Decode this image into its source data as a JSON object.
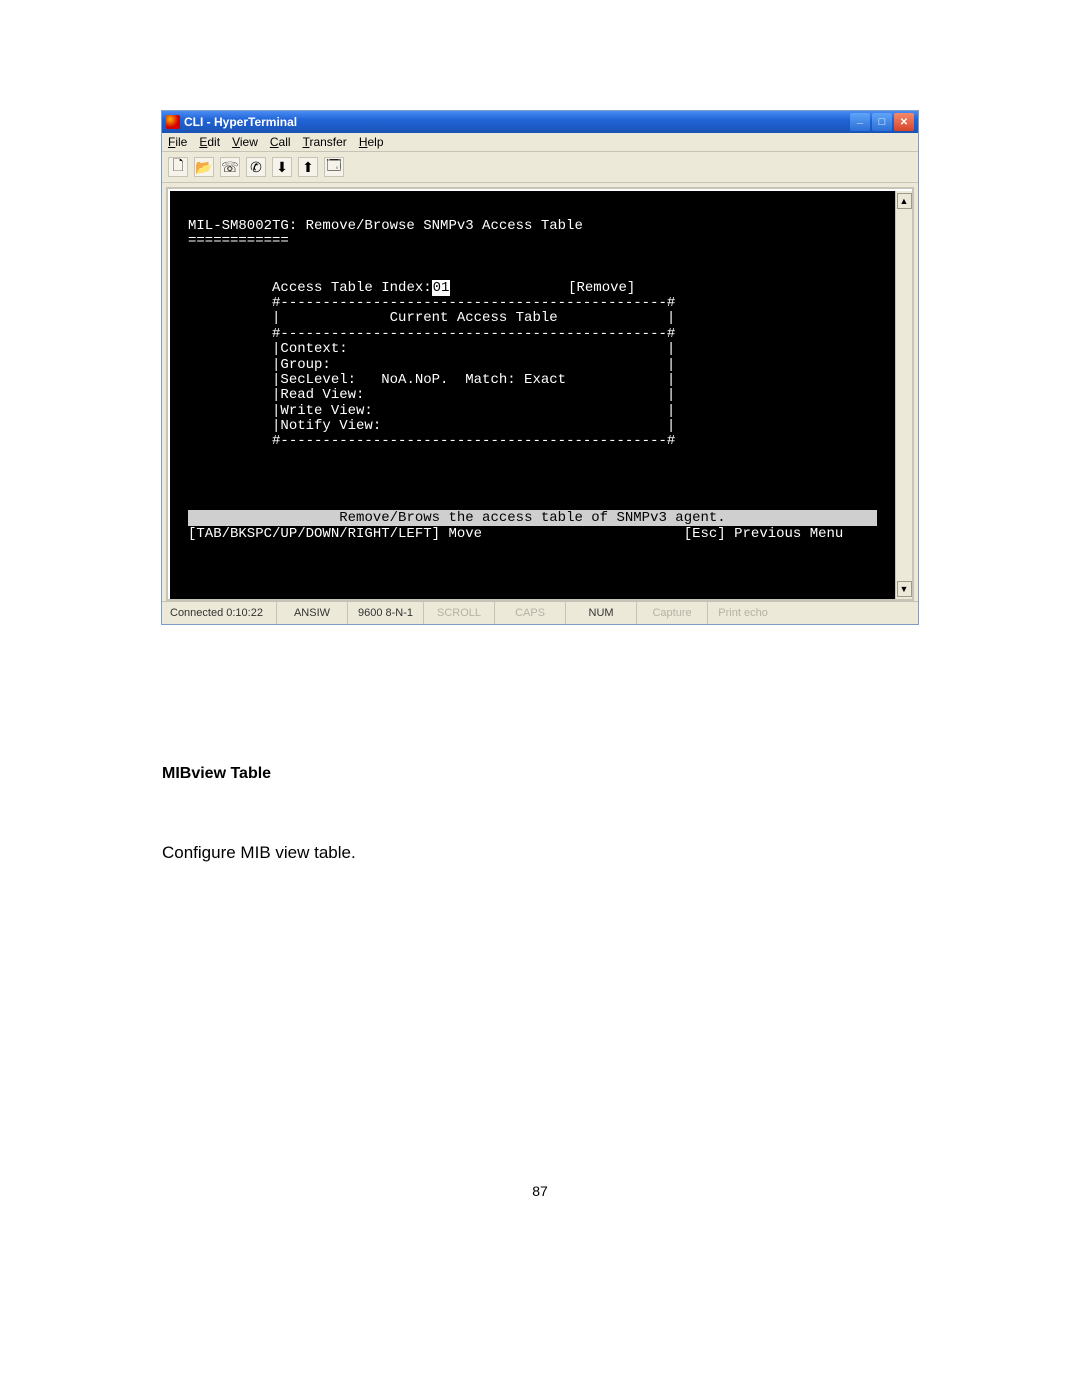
{
  "window": {
    "title": "CLI - HyperTerminal"
  },
  "menu": {
    "file": "File",
    "edit": "Edit",
    "view": "View",
    "call": "Call",
    "transfer": "Transfer",
    "help": "Help"
  },
  "terminal": {
    "header_line": "MIL-SM8002TG: Remove/Browse SNMPv3 Access Table",
    "header_underline": "============",
    "index_label": "Access Table Index:",
    "index_value": "01",
    "remove_label": "[Remove]",
    "border_top": "#----------------------------------------------#",
    "table_title_line": "|             Current Access Table             |",
    "border_mid": "#----------------------------------------------#",
    "row_context": "|Context:                                      |",
    "row_group": "|Group:                                        |",
    "row_seclevel": "|SecLevel:   NoA.NoP.  Match: Exact            |",
    "row_readview": "|Read View:                                    |",
    "row_writeview": "|Write View:                                   |",
    "row_notify": "|Notify View:                                  |",
    "border_bot": "#----------------------------------------------#",
    "status_msg": "Remove/Brows the access table of SNMPv3 agent.",
    "footer_left": "[TAB/BKSPC/UP/DOWN/RIGHT/LEFT] Move",
    "footer_right": "[Esc] Previous Menu"
  },
  "statusbar": {
    "connected": "Connected 0:10:22",
    "emulation": "ANSIW",
    "port": "9600 8-N-1",
    "scroll": "SCROLL",
    "caps": "CAPS",
    "num": "NUM",
    "capture": "Capture",
    "printecho": "Print echo"
  },
  "document": {
    "heading": "MIBview Table",
    "paragraph": "Configure MIB view table.",
    "page_number": "87"
  }
}
